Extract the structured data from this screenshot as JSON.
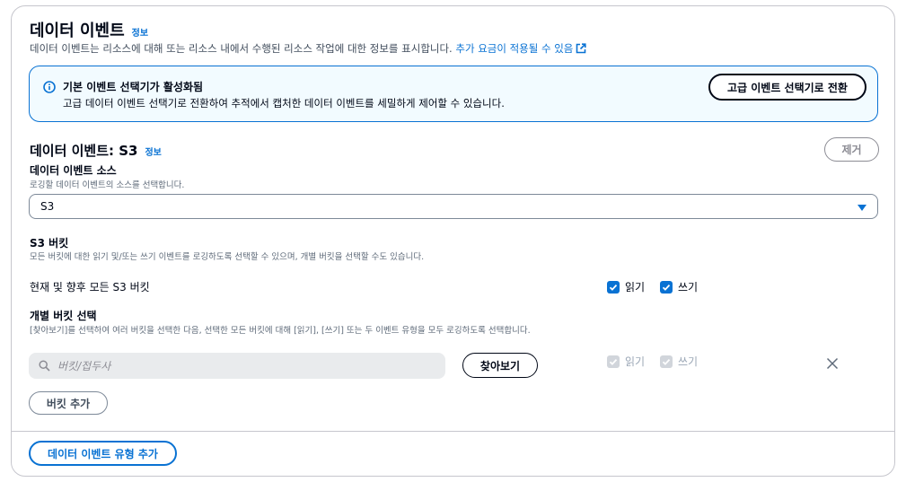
{
  "header": {
    "title": "데이터 이벤트",
    "info": "정보",
    "description": "데이터 이벤트는 리소스에 대해 또는 리소스 내에서 수행된 리소스 작업에 대한 정보를 표시합니다.",
    "pricing_link": "추가 요금이 적용될 수 있음",
    "icons": {
      "external": "external-link-icon"
    }
  },
  "alert": {
    "title": "기본 이벤트 선택기가 활성화됨",
    "body": "고급 데이터 이벤트 선택기로 전환하여 추적에서 캡처한 데이터 이벤트를 세밀하게 제어할 수 있습니다.",
    "button": "고급 이벤트 선택기로 전환",
    "icon": "info-icon"
  },
  "section": {
    "title": "데이터 이벤트: S3",
    "info": "정보",
    "remove_button": "제거"
  },
  "source": {
    "label": "데이터 이벤트 소스",
    "description": "로깅할 데이터 이벤트의 소스를 선택합니다.",
    "selected": "S3"
  },
  "buckets": {
    "label": "S3 버킷",
    "description": "모든 버킷에 대한 읽기 및/또는 쓰기 이벤트를 로깅하도록 선택할 수 있으며, 개별 버킷을 선택할 수도 있습니다.",
    "all_row_label": "현재 및 향후 모든 S3 버킷",
    "read": "읽기",
    "write": "쓰기",
    "all_read_checked": true,
    "all_write_checked": true
  },
  "individual": {
    "label": "개별 버킷 선택",
    "description": "[찾아보기]를 선택하여 여러 버킷을 선택한 다음, 선택한 모든 버킷에 대해 [읽기], [쓰기] 또는 두 이벤트 유형을 모두 로깅하도록 선택합니다.",
    "search_placeholder": "버킷/접두사",
    "browse_button": "찾아보기",
    "read": "읽기",
    "write": "쓰기",
    "add_bucket_button": "버킷 추가"
  },
  "footer": {
    "add_type_button": "데이터 이벤트 유형 추가"
  },
  "colors": {
    "accent": "#0972d3",
    "alert_bg": "#f2fbff",
    "text": "#000716",
    "disabled": "#d1d5db"
  }
}
